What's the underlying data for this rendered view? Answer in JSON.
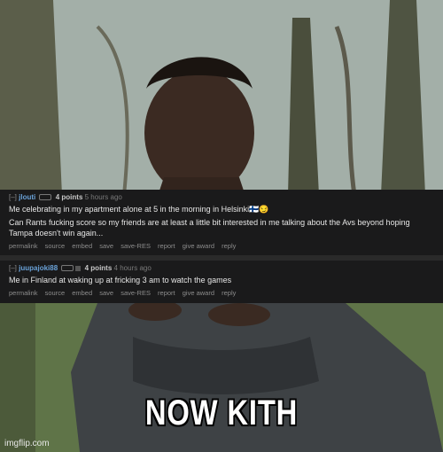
{
  "comments": [
    {
      "toggle": "[–]",
      "user": "jlouti",
      "points": "4 points",
      "time": "5 hours ago",
      "lines": [
        "Me celebrating in my apartment alone at 5 in the morning in Helsinki🇫🇮😏",
        "",
        "Can Rants fucking score so my friends are at least a little bit interested in me talking about the Avs beyond hoping",
        "Tampa doesn't win again..."
      ],
      "actions": [
        "permalink",
        "source",
        "embed",
        "save",
        "save-RES",
        "report",
        "give award",
        "reply"
      ]
    },
    {
      "toggle": "[–]",
      "user": "juupajoki88",
      "points": "4 points",
      "time": "4 hours ago",
      "lines": [
        "Me in Finland at waking up at fricking 3 am to watch the games"
      ],
      "actions": [
        "permalink",
        "source",
        "embed",
        "save",
        "save-RES",
        "report",
        "give award",
        "reply"
      ]
    }
  ],
  "caption": "NOW KITH",
  "watermark": "imgflip.com",
  "colors": {
    "panel": "#1a1a1b",
    "username": "#6aa2d8",
    "text": "#e6e6e6"
  }
}
